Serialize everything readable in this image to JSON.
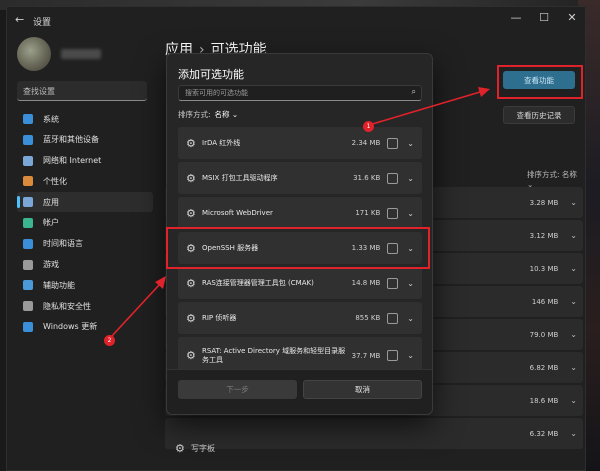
{
  "window": {
    "title": "设置",
    "back_glyph": "←",
    "controls": [
      "—",
      "☐",
      "✕"
    ]
  },
  "sidebar": {
    "search_placeholder": "查找设置",
    "items": [
      {
        "label": "系统",
        "icon": "monitor-icon",
        "color": "#3b8fd9",
        "active": false
      },
      {
        "label": "蓝牙和其他设备",
        "icon": "bluetooth-icon",
        "color": "#3b8fd9",
        "active": false
      },
      {
        "label": "网络和 Internet",
        "icon": "wifi-icon",
        "color": "#7aa7d8",
        "active": false
      },
      {
        "label": "个性化",
        "icon": "brush-icon",
        "color": "#d98a3b",
        "active": false
      },
      {
        "label": "应用",
        "icon": "apps-icon",
        "color": "#7aa7d8",
        "active": true
      },
      {
        "label": "帐户",
        "icon": "person-icon",
        "color": "#3bb58f",
        "active": false
      },
      {
        "label": "时间和语言",
        "icon": "globe-icon",
        "color": "#3b8fd9",
        "active": false
      },
      {
        "label": "游戏",
        "icon": "gamepad-icon",
        "color": "#9a9a9a",
        "active": false
      },
      {
        "label": "辅助功能",
        "icon": "accessibility-icon",
        "color": "#4a9ad9",
        "active": false
      },
      {
        "label": "隐私和安全性",
        "icon": "shield-icon",
        "color": "#9a9a9a",
        "active": false
      },
      {
        "label": "Windows 更新",
        "icon": "update-icon",
        "color": "#3b8fd9",
        "active": false
      }
    ]
  },
  "header": {
    "crumb_parent": "应用",
    "crumb_sep": "›",
    "crumb_current": "可选功能"
  },
  "page": {
    "view_features_button": "查看功能",
    "history_button": "查看历史记录",
    "sort_label": "排序方式: 名称 ⌄",
    "installed_sizes": [
      "3.28 MB",
      "3.12 MB",
      "10.3 MB",
      "146 MB",
      "79.0 MB",
      "6.82 MB",
      "18.6 MB",
      "6.32 MB"
    ],
    "bottom_item": "写字板"
  },
  "dialog": {
    "title": "添加可选功能",
    "search_placeholder": "搜索可用的可选功能",
    "sort_prefix": "排序方式:",
    "sort_value": "名称 ⌄",
    "features": [
      {
        "name": "IrDA 红外线",
        "size": "2.34 MB",
        "checked": false,
        "highlight": false
      },
      {
        "name": "MSIX 打包工具驱动程序",
        "size": "31.6 KB",
        "checked": false,
        "highlight": false
      },
      {
        "name": "Microsoft WebDriver",
        "size": "171 KB",
        "checked": false,
        "highlight": false
      },
      {
        "name": "OpenSSH 服务器",
        "size": "1.33 MB",
        "checked": false,
        "highlight": true
      },
      {
        "name": "RAS连接管理器管理工具包 (CMAK)",
        "size": "14.8 MB",
        "checked": false,
        "highlight": false
      },
      {
        "name": "RIP 侦听器",
        "size": "855 KB",
        "checked": false,
        "highlight": false
      },
      {
        "name": "RSAT: Active Directory 域服务和轻型目录服务工具",
        "size": "37.7 MB",
        "checked": false,
        "highlight": false
      }
    ],
    "next_button": "下一步",
    "cancel_button": "取消"
  },
  "annotations": {
    "step1": "1",
    "step2": "2",
    "color": "#e0222a"
  },
  "glyphs": {
    "gear": "⚙",
    "chevron": "⌄",
    "search": "⌕"
  }
}
